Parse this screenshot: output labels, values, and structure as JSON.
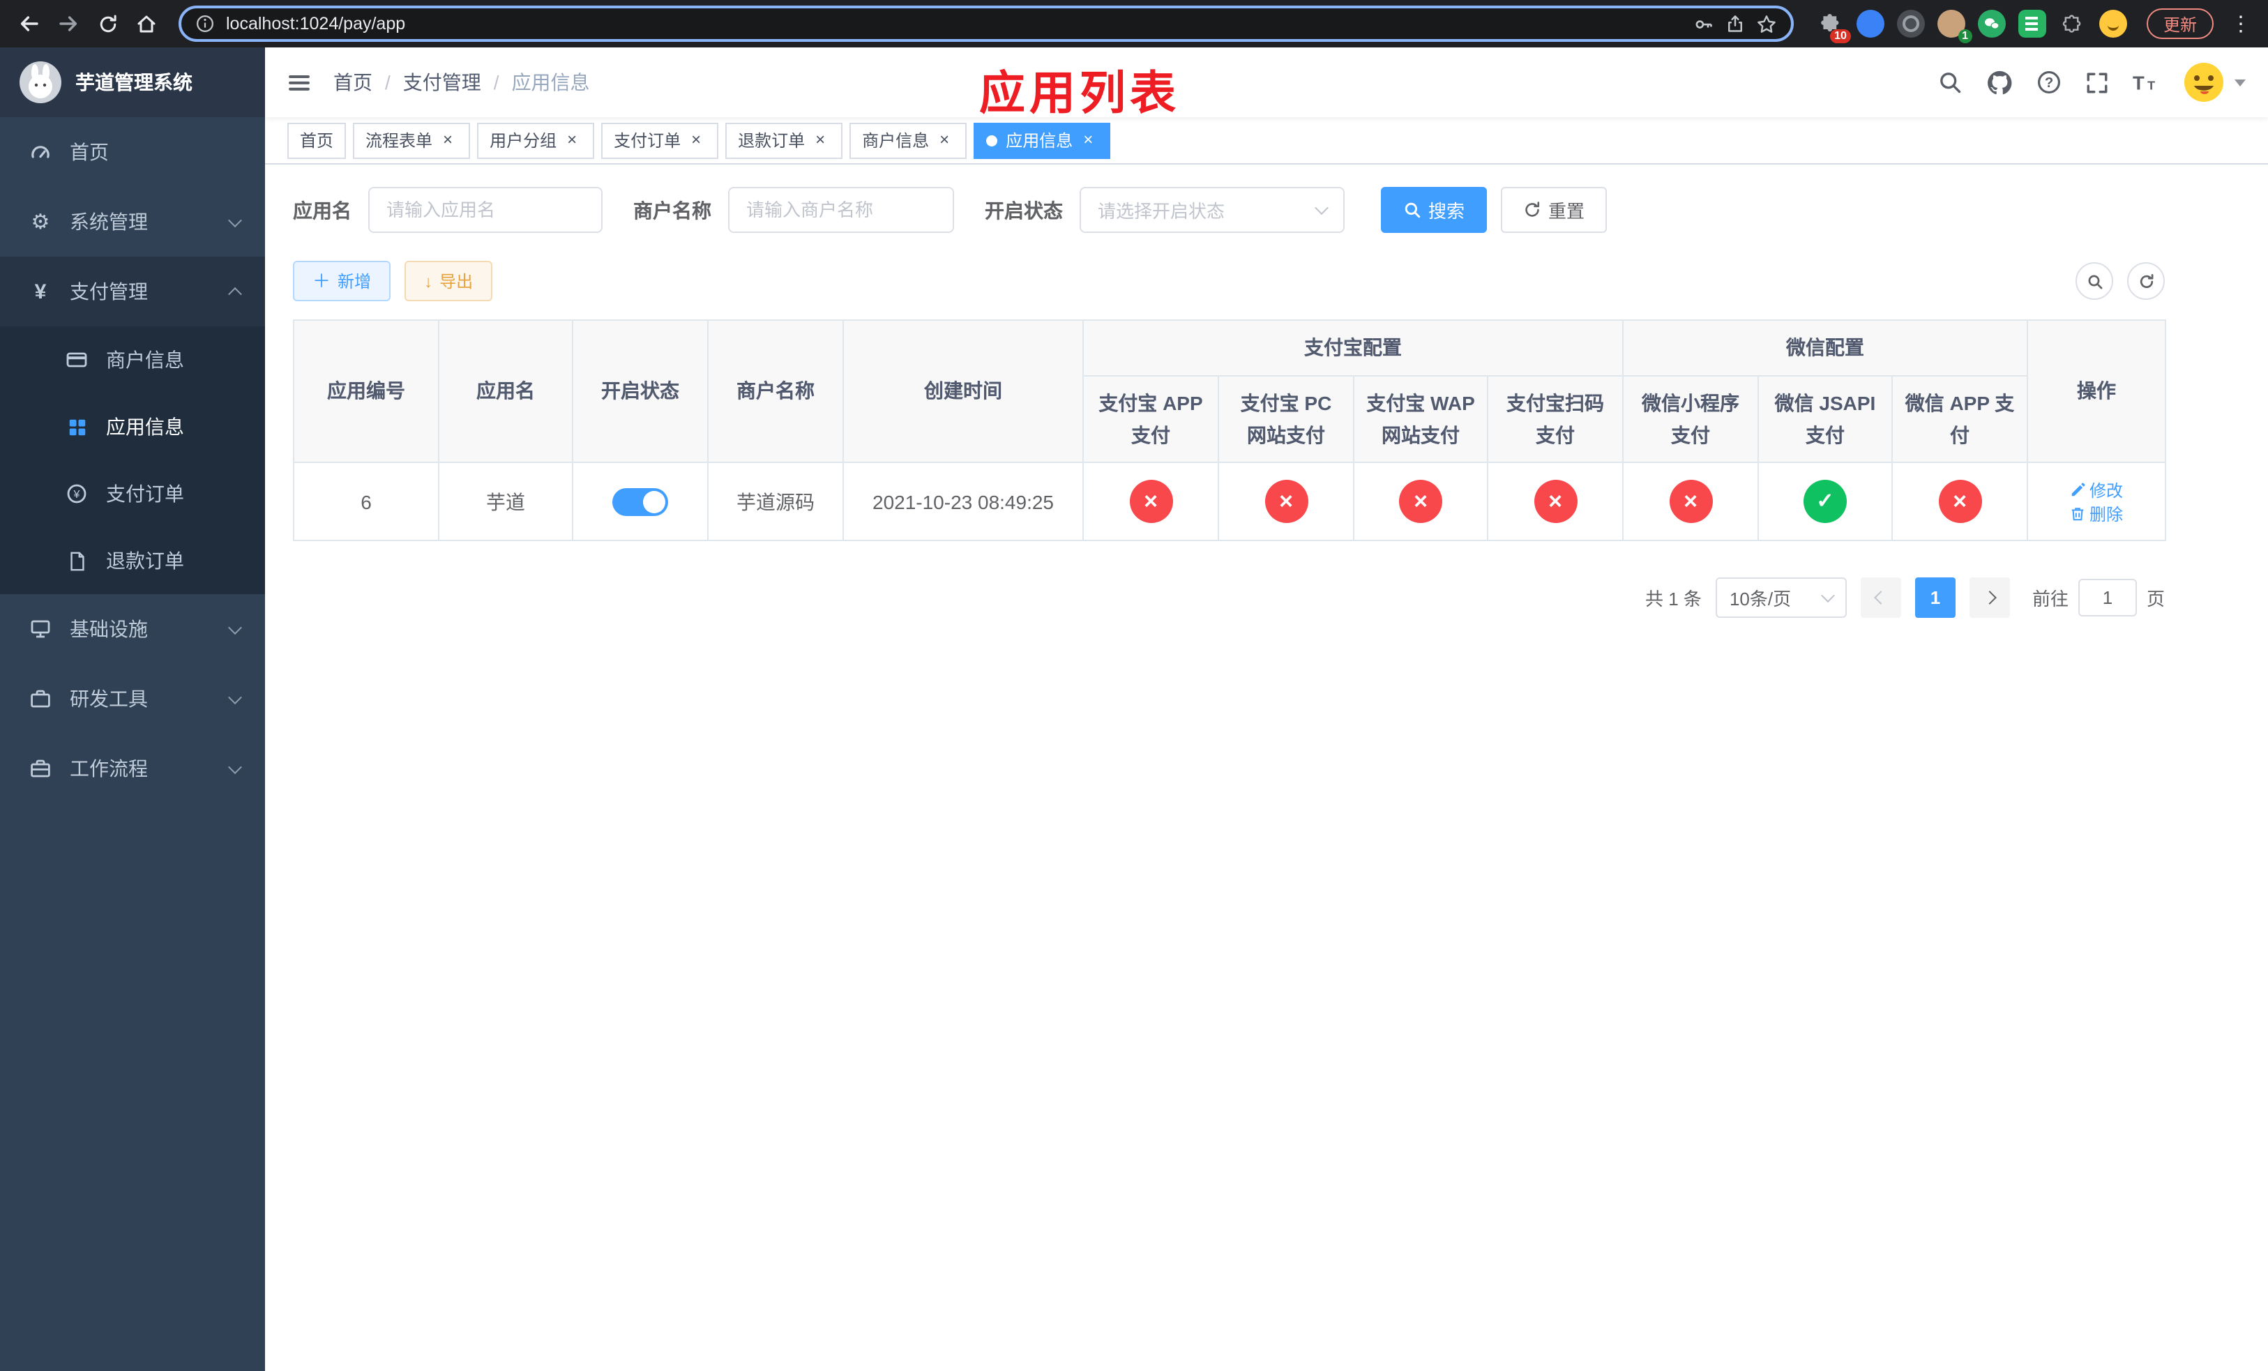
{
  "colors": {
    "primary": "#409eff",
    "success": "#0fc160",
    "danger": "#f8484c",
    "annotation": "#ee1d23"
  },
  "browser": {
    "url": "localhost:1024/pay/app",
    "update_label": "更新",
    "ext_badges": {
      "puzzle": "10",
      "profile": "1"
    }
  },
  "sidebar": {
    "title": "芋道管理系统",
    "items": [
      {
        "label": "首页"
      },
      {
        "label": "系统管理"
      },
      {
        "label": "支付管理"
      },
      {
        "label": "基础设施"
      },
      {
        "label": "研发工具"
      },
      {
        "label": "工作流程"
      }
    ],
    "payment_submenu": [
      {
        "label": "商户信息"
      },
      {
        "label": "应用信息"
      },
      {
        "label": "支付订单"
      },
      {
        "label": "退款订单"
      }
    ]
  },
  "header": {
    "breadcrumb": [
      "首页",
      "支付管理",
      "应用信息"
    ],
    "annotation": "应用列表"
  },
  "tabs": [
    {
      "label": "首页"
    },
    {
      "label": "流程表单"
    },
    {
      "label": "用户分组"
    },
    {
      "label": "支付订单"
    },
    {
      "label": "退款订单"
    },
    {
      "label": "商户信息"
    },
    {
      "label": "应用信息"
    }
  ],
  "filters": {
    "app_name_label": "应用名",
    "app_name_placeholder": "请输入应用名",
    "merchant_label": "商户名称",
    "merchant_placeholder": "请输入商户名称",
    "status_label": "开启状态",
    "status_placeholder": "请选择开启状态",
    "search_label": "搜索",
    "reset_label": "重置"
  },
  "toolbar": {
    "add_label": "新增",
    "export_label": "导出"
  },
  "table": {
    "groups": {
      "alipay": "支付宝配置",
      "wechat": "微信配置"
    },
    "columns": [
      "应用编号",
      "应用名",
      "开启状态",
      "商户名称",
      "创建时间",
      "支付宝 APP 支付",
      "支付宝 PC 网站支付",
      "支付宝 WAP 网站支付",
      "支付宝扫码支付",
      "微信小程序支付",
      "微信 JSAPI 支付",
      "微信 APP 支付",
      "操作"
    ],
    "row": {
      "id": "6",
      "name": "芋道",
      "enabled": true,
      "merchant": "芋道源码",
      "created": "2021-10-23 08:49:25",
      "statuses": [
        false,
        false,
        false,
        false,
        false,
        true,
        false
      ],
      "edit_label": "修改",
      "delete_label": "删除"
    }
  },
  "pagination": {
    "total": "共 1 条",
    "page_size": "10条/页",
    "page": "1",
    "goto_label": "前往",
    "goto_value": "1",
    "page_unit": "页"
  }
}
